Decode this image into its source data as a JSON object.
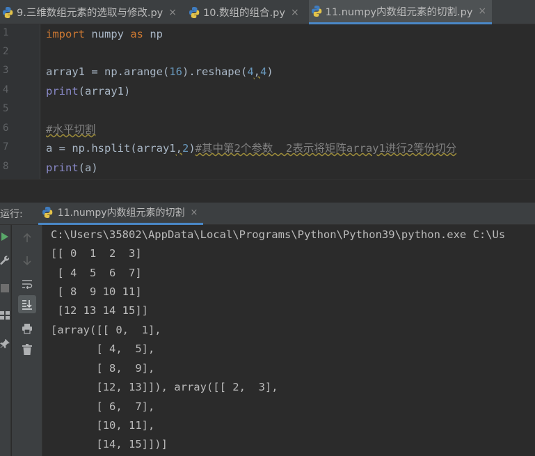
{
  "tabs": [
    {
      "label": "9.三维数组元素的选取与修改.py",
      "active": false
    },
    {
      "label": "10.数组的组合.py",
      "active": false
    },
    {
      "label": "11.numpy内数组元素的切割.py",
      "active": true
    }
  ],
  "close_glyph": "×",
  "editor": {
    "line_numbers": [
      "1",
      "2",
      "3",
      "4",
      "5",
      "6",
      "7",
      "8"
    ],
    "lines": {
      "l1": {
        "kw1": "import",
        "mid": " numpy ",
        "kw2": "as",
        "end": " np"
      },
      "l3": {
        "a": "array1 = np.arange(",
        "n1": "16",
        "b": ").reshape(",
        "n2": "4",
        "c": ",",
        "n3": "4",
        "d": ")"
      },
      "l4": {
        "fn": "print",
        "rest": "(array1)"
      },
      "l6": {
        "comment": "#水平切割"
      },
      "l7": {
        "a": "a = np.hsplit(array1",
        "c": ",",
        "n": "2",
        "b": ")",
        "comment": "#其中第2个参数  2表示将矩阵array1进行2等份切分"
      },
      "l8": {
        "fn": "print",
        "rest": "(a)"
      }
    }
  },
  "run_panel": {
    "label": "运行:",
    "tab_label": "11.numpy内数组元素的切割",
    "output": [
      "C:\\Users\\35802\\AppData\\Local\\Programs\\Python\\Python39\\python.exe C:\\Us",
      "[[ 0  1  2  3]",
      " [ 4  5  6  7]",
      " [ 8  9 10 11]",
      " [12 13 14 15]]",
      "[array([[ 0,  1],",
      "       [ 4,  5],",
      "       [ 8,  9],",
      "       [12, 13]]), array([[ 2,  3],",
      "       [ 6,  7],",
      "       [10, 11],",
      "       [14, 15]])]"
    ]
  },
  "colors": {
    "keyword": "#cc7832",
    "number": "#6897bb",
    "builtin": "#8888c6",
    "comment": "#808080",
    "text": "#a9b7c6",
    "accent": "#4a88c7"
  }
}
